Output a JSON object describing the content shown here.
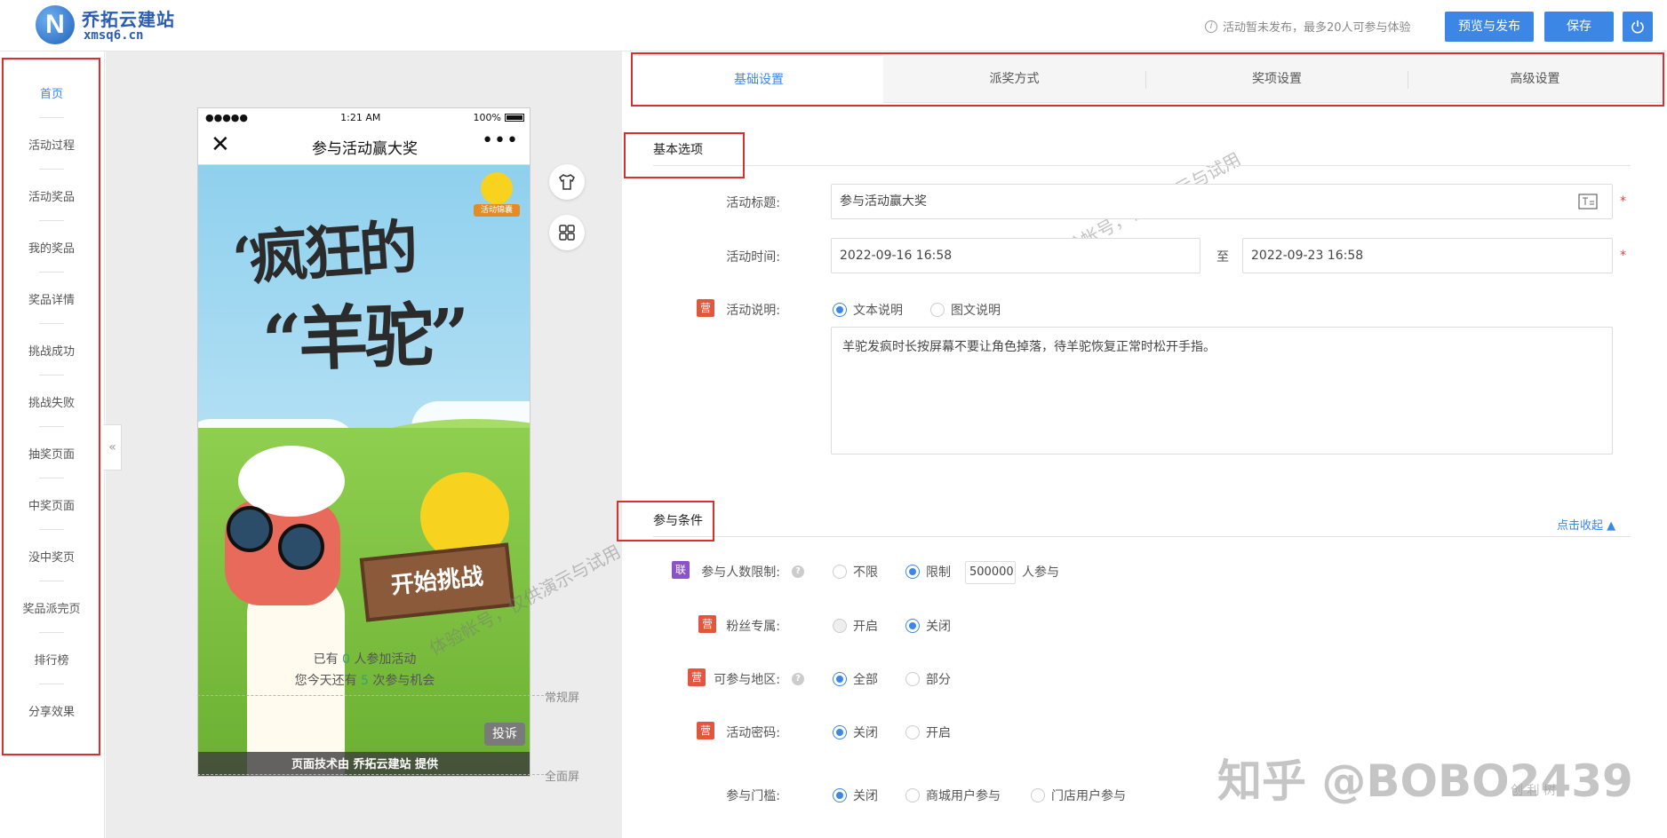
{
  "brand": {
    "name": "乔拓云建站",
    "domain": "xmsq6.cn",
    "logo_letter": "N"
  },
  "header": {
    "notice": "活动暂未发布，最多20人可参与体验",
    "preview_publish": "预览与发布",
    "save": "保存"
  },
  "sidebar": {
    "items": [
      {
        "label": "首页",
        "active": true
      },
      {
        "label": "活动过程"
      },
      {
        "label": "活动奖品"
      },
      {
        "label": "我的奖品"
      },
      {
        "label": "奖品详情"
      },
      {
        "label": "挑战成功"
      },
      {
        "label": "挑战失败"
      },
      {
        "label": "抽奖页面"
      },
      {
        "label": "中奖页面"
      },
      {
        "label": "没中奖页"
      },
      {
        "label": "奖品派完页"
      },
      {
        "label": "排行榜"
      },
      {
        "label": "分享效果"
      }
    ],
    "collapse": "«"
  },
  "phone": {
    "status": {
      "dots": "●●●●●",
      "time": "1:21 AM",
      "battery": "100%"
    },
    "title": "参与活动赢大奖",
    "close": "✕",
    "more": "•••",
    "badge": "活动锦囊",
    "headline1": "‘疯狂的",
    "headline2": "“羊驼”",
    "start_button": "开始挑战",
    "joined_prefix": "已有",
    "joined_count": "0",
    "joined_suffix": "人参加活动",
    "chances_prefix": "您今天还有",
    "chances_count": "5",
    "chances_suffix": "次参与机会",
    "complain": "投诉",
    "footer": "页面技术由 乔拓云建站 提供"
  },
  "guides": {
    "normal": "常规屏",
    "full": "全面屏"
  },
  "watermarks": {
    "demo": "体验帐号，仅供演示与试用",
    "zhihu": "知乎 @BOBO2439",
    "chuangli": "创 利 树"
  },
  "tabs": [
    {
      "label": "基础设置",
      "active": true
    },
    {
      "label": "派奖方式"
    },
    {
      "label": "奖项设置"
    },
    {
      "label": "高级设置"
    }
  ],
  "basic": {
    "section_title": "基本选项",
    "title_label": "活动标题:",
    "title_value": "参与活动赢大奖",
    "time_label": "活动时间:",
    "start_time": "2022-09-16 16:58",
    "to": "至",
    "end_time": "2022-09-23 16:58",
    "desc_tag": "营",
    "desc_label": "活动说明:",
    "desc_text_option": "文本说明",
    "desc_image_option": "图文说明",
    "desc_text": "羊驼发疯时长按屏幕不要让角色掉落，待羊驼恢复正常时松开手指。",
    "required": "*"
  },
  "conditions": {
    "section_title": "参与条件",
    "collapse": "点击收起 ▲",
    "limit_tag": "联",
    "limit_label": "参与人数限制:",
    "limit_unlimited": "不限",
    "limit_limited": "限制",
    "limit_value": "500000",
    "limit_suffix": "人参与",
    "fans_tag": "营",
    "fans_label": "粉丝专属:",
    "fans_on": "开启",
    "fans_off": "关闭",
    "region_tag": "营",
    "region_label": "可参与地区:",
    "region_all": "全部",
    "region_part": "部分",
    "pwd_tag": "营",
    "pwd_label": "活动密码:",
    "pwd_off": "关闭",
    "pwd_on": "开启",
    "threshold_label": "参与门槛:",
    "threshold_off": "关闭",
    "threshold_mall": "商城用户参与",
    "threshold_store": "门店用户参与",
    "help": "?"
  },
  "colors": {
    "accent": "#3c87e6",
    "highlight_box": "#d9302b",
    "tag_ying": "#e3563e",
    "tag_lian": "#8a53c8"
  }
}
